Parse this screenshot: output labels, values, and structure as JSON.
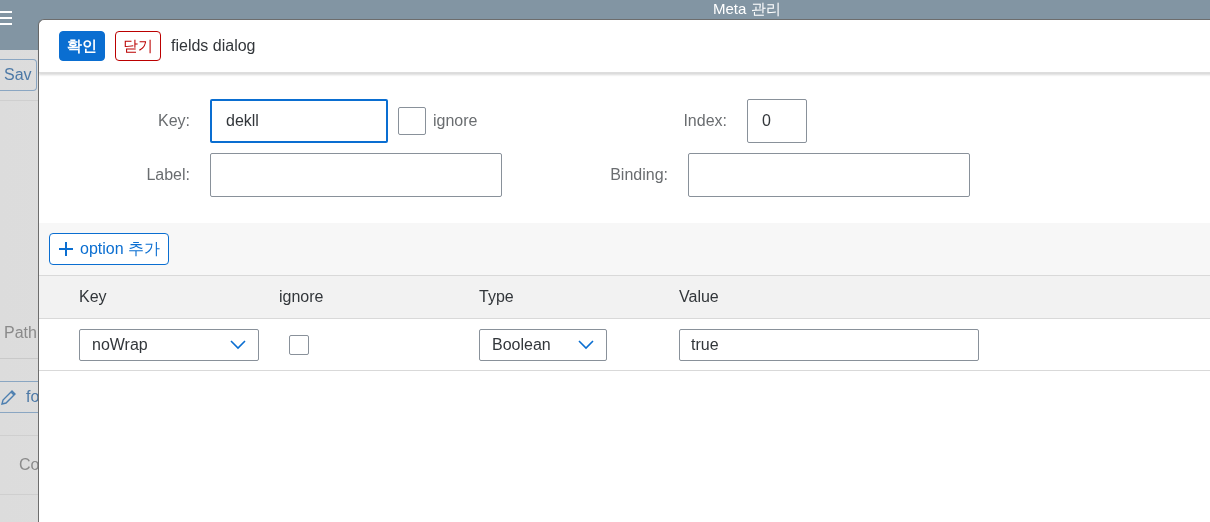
{
  "background": {
    "title": "Meta 관리",
    "save_button": "Sav",
    "path_label": "Path",
    "edit_button": "fo",
    "column_label": "Co"
  },
  "dialog": {
    "buttons": [
      {
        "label": "확인",
        "kind": "primary"
      },
      {
        "label": "닫기",
        "kind": "reject"
      }
    ],
    "title": "fields dialog",
    "form": {
      "key": {
        "label": "Key:",
        "value": "dekll",
        "focused": true
      },
      "ignore": {
        "label": "ignore",
        "checked": false
      },
      "index": {
        "label": "Index:",
        "value": "0"
      },
      "label": {
        "label": "Label:"
      },
      "binding": {
        "label": "Binding:"
      }
    },
    "add_option_button": "option 추가",
    "table": {
      "columns": [
        "Key",
        "ignore",
        "Type",
        "Value"
      ],
      "rows": [
        {
          "key": "noWrap",
          "ignore": false,
          "type": "Boolean",
          "value": "true"
        }
      ]
    }
  }
}
